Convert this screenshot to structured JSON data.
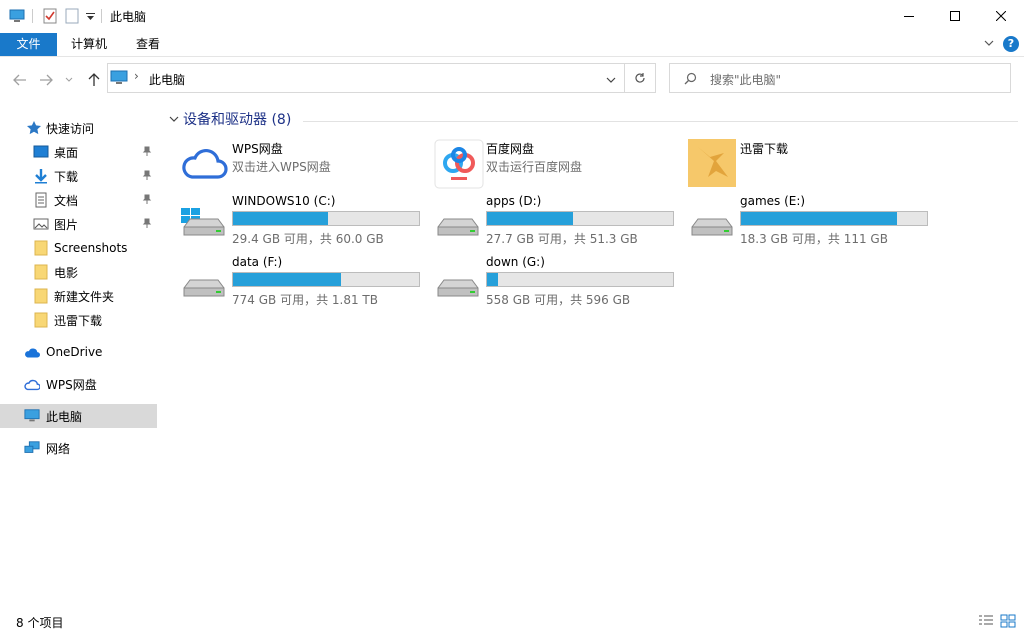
{
  "window": {
    "title": "此电脑"
  },
  "ribbon": {
    "tabs": [
      "文件",
      "计算机",
      "查看"
    ]
  },
  "address": {
    "location": "此电脑"
  },
  "search": {
    "placeholder": "搜索\"此电脑\""
  },
  "sidebar": {
    "quick_access": "快速访问",
    "items": [
      {
        "label": "桌面",
        "icon": "desktop-icon",
        "pinned": true
      },
      {
        "label": "下载",
        "icon": "download-icon",
        "pinned": true
      },
      {
        "label": "文档",
        "icon": "documents-icon",
        "pinned": true
      },
      {
        "label": "图片",
        "icon": "pictures-icon",
        "pinned": true
      },
      {
        "label": "Screenshots",
        "icon": "folder-icon",
        "pinned": false
      },
      {
        "label": "电影",
        "icon": "folder-icon",
        "pinned": false
      },
      {
        "label": "新建文件夹",
        "icon": "folder-icon",
        "pinned": false
      },
      {
        "label": "迅雷下载",
        "icon": "folder-icon",
        "pinned": false
      }
    ],
    "onedrive": "OneDrive",
    "wps": "WPS网盘",
    "thispc": "此电脑",
    "network": "网络"
  },
  "main": {
    "group_title": "设备和驱动器 (8)",
    "apps": [
      {
        "name": "WPS网盘",
        "sub": "双击进入WPS网盘",
        "icon": "wps-cloud-icon"
      },
      {
        "name": "百度网盘",
        "sub": "双击运行百度网盘",
        "icon": "baidu-netdisk-icon"
      },
      {
        "name": "迅雷下载",
        "sub": "",
        "icon": "xunlei-folder-icon"
      }
    ],
    "drives": [
      {
        "name": "WINDOWS10 (C:)",
        "info": "29.4 GB 可用，共 60.0 GB",
        "used_fraction": 0.51
      },
      {
        "name": "apps (D:)",
        "info": "27.7 GB 可用，共 51.3 GB",
        "used_fraction": 0.46
      },
      {
        "name": "games (E:)",
        "info": "18.3 GB 可用，共 111 GB",
        "used_fraction": 0.84
      },
      {
        "name": "data (F:)",
        "info": "774 GB 可用，共 1.81 TB",
        "used_fraction": 0.58
      },
      {
        "name": "down (G:)",
        "info": "558 GB 可用，共 596 GB",
        "used_fraction": 0.06
      }
    ]
  },
  "status": {
    "count": "8 个项目"
  },
  "colors": {
    "accent": "#1979ca",
    "bar_fill": "#26a0da",
    "group_title": "#1e3287"
  }
}
